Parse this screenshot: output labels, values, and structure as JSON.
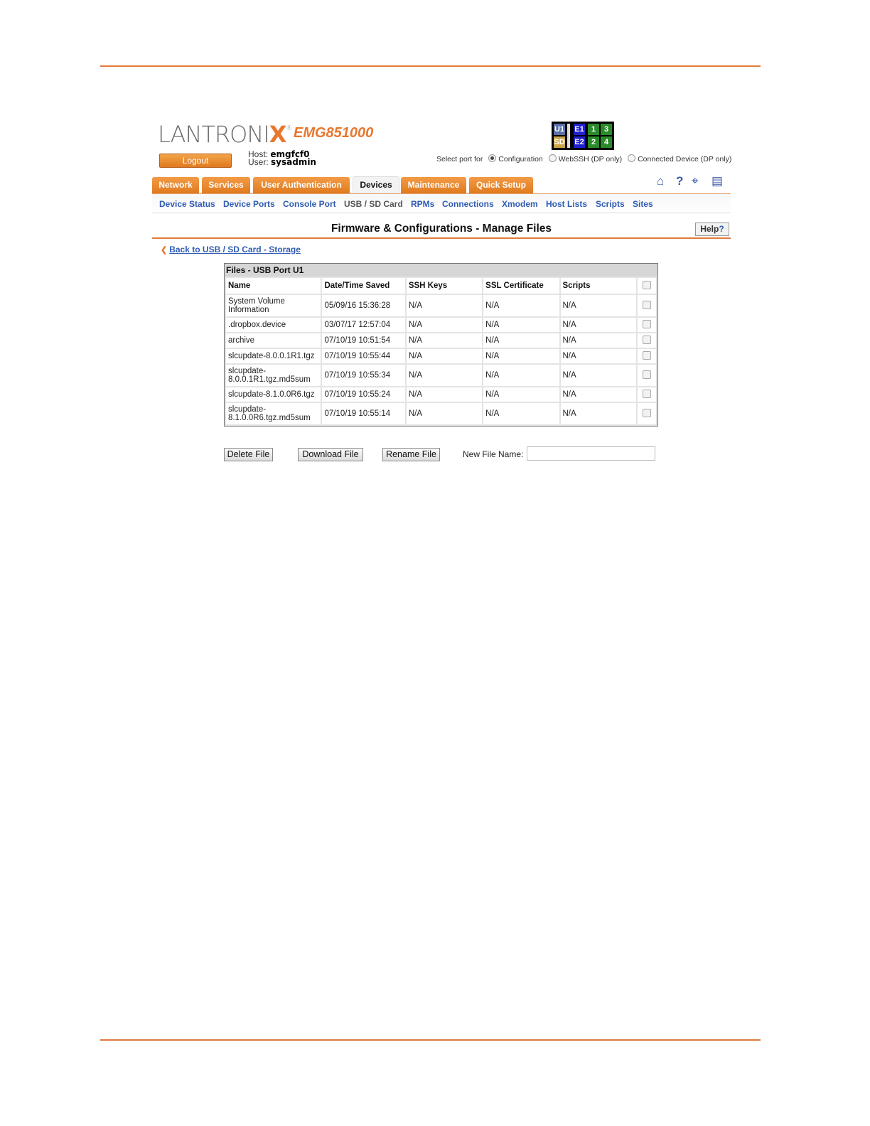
{
  "header": {
    "logo_main": "LANTRONI",
    "logo_x": "X",
    "logo_reg": "®",
    "model": "EMG851000",
    "logout_label": "Logout",
    "host_label": "Host:",
    "host_value": "emgfcf0",
    "user_label": "User:",
    "user_value": "sysadmin",
    "ports": {
      "u1": "U1",
      "sd": "SD",
      "e1": "E1",
      "e2": "E2",
      "p1": "1",
      "p2": "2",
      "p3": "3",
      "p4": "4",
      "colors": {
        "usb": "#5a6fa8",
        "sd": "#c9a44a",
        "eth": "#2020d0",
        "serial": "#2a8a2a"
      }
    },
    "select_port_label": "Select port for",
    "select_options": [
      "Configuration",
      "WebSSH (DP only)",
      "Connected Device (DP only)"
    ],
    "selected_option": "Configuration"
  },
  "tabs": [
    "Network",
    "Services",
    "User Authentication",
    "Devices",
    "Maintenance",
    "Quick Setup"
  ],
  "active_tab": "Devices",
  "toolbar_icons": [
    "home-icon",
    "help-question-icon",
    "crosshair-icon",
    "list-icon"
  ],
  "subnav": [
    "Device Status",
    "Device Ports",
    "Console Port",
    "USB / SD Card",
    "RPMs",
    "Connections",
    "Xmodem",
    "Host Lists",
    "Scripts",
    "Sites"
  ],
  "current_subnav": "USB / SD Card",
  "page_title": "Firmware & Configurations - Manage Files",
  "help_label": "Help",
  "help_mark": "?",
  "back_link": "Back to USB / SD Card - Storage",
  "files_table": {
    "caption": "Files - USB Port U1",
    "columns": [
      "Name",
      "Date/Time Saved",
      "SSH Keys",
      "SSL Certificate",
      "Scripts"
    ],
    "rows": [
      {
        "name": "System Volume Information",
        "date": "05/09/16 15:36:28",
        "ssh": "N/A",
        "ssl": "N/A",
        "scripts": "N/A"
      },
      {
        "name": ".dropbox.device",
        "date": "03/07/17 12:57:04",
        "ssh": "N/A",
        "ssl": "N/A",
        "scripts": "N/A"
      },
      {
        "name": "archive",
        "date": "07/10/19 10:51:54",
        "ssh": "N/A",
        "ssl": "N/A",
        "scripts": "N/A"
      },
      {
        "name": "slcupdate-8.0.0.1R1.tgz",
        "date": "07/10/19 10:55:44",
        "ssh": "N/A",
        "ssl": "N/A",
        "scripts": "N/A"
      },
      {
        "name": "slcupdate-8.0.0.1R1.tgz.md5sum",
        "date": "07/10/19 10:55:34",
        "ssh": "N/A",
        "ssl": "N/A",
        "scripts": "N/A"
      },
      {
        "name": "slcupdate-8.1.0.0R6.tgz",
        "date": "07/10/19 10:55:24",
        "ssh": "N/A",
        "ssl": "N/A",
        "scripts": "N/A"
      },
      {
        "name": "slcupdate-8.1.0.0R6.tgz.md5sum",
        "date": "07/10/19 10:55:14",
        "ssh": "N/A",
        "ssl": "N/A",
        "scripts": "N/A"
      }
    ]
  },
  "actions": {
    "delete_label": "Delete File",
    "download_label": "Download File",
    "rename_label": "Rename File",
    "new_file_name_label": "New File Name:",
    "new_file_name_value": ""
  }
}
